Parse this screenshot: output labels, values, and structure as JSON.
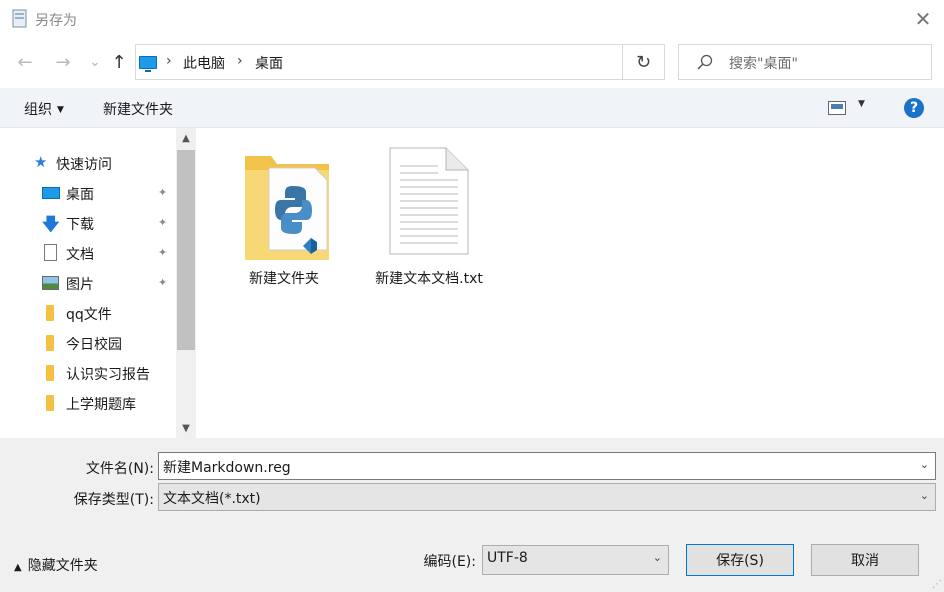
{
  "window": {
    "title": "另存为",
    "close_glyph": "✕"
  },
  "nav": {
    "back_glyph": "←",
    "forward_glyph": "→",
    "recent_glyph": "⌄",
    "up_glyph": "↑",
    "breadcrumb": [
      "此电脑",
      "桌面"
    ],
    "separator": "›",
    "refresh_glyph": "↻",
    "search_placeholder": "搜索\"桌面\""
  },
  "toolbar": {
    "organize_label": "组织",
    "new_folder_label": "新建文件夹",
    "help_glyph": "?"
  },
  "sidebar": {
    "items": [
      {
        "label": "快速访问",
        "icon": "star-icon",
        "pinned": false
      },
      {
        "label": "桌面",
        "icon": "desktop-icon",
        "pinned": true
      },
      {
        "label": "下载",
        "icon": "download-icon",
        "pinned": true
      },
      {
        "label": "文档",
        "icon": "document-icon",
        "pinned": true
      },
      {
        "label": "图片",
        "icon": "picture-icon",
        "pinned": true
      },
      {
        "label": "qq文件",
        "icon": "folder-icon",
        "pinned": false
      },
      {
        "label": "今日校园",
        "icon": "folder-icon",
        "pinned": false
      },
      {
        "label": "认识实习报告",
        "icon": "folder-icon",
        "pinned": false
      },
      {
        "label": "上学期题库",
        "icon": "folder-icon",
        "pinned": false
      }
    ],
    "pin_glyph": "📌",
    "scroll_up_glyph": "▲",
    "scroll_down_glyph": "▼"
  },
  "files": [
    {
      "name": "新建文件夹",
      "icon": "folder-python-vscode-icon"
    },
    {
      "name": "新建文本文档.txt",
      "icon": "text-file-icon"
    }
  ],
  "form": {
    "filename_label": "文件名(N):",
    "filename_value": "新建Markdown.reg",
    "filetype_label": "保存类型(T):",
    "filetype_value": "文本文档(*.txt)",
    "encoding_label": "编码(E):",
    "encoding_value": "UTF-8",
    "dropdown_glyph": "⌄"
  },
  "footer": {
    "hide_folders_label": "隐藏文件夹",
    "hide_glyph": "▲",
    "save_label": "保存(S)",
    "cancel_label": "取消"
  },
  "colors": {
    "accent": "#0078d7",
    "toolbar_bg": "#f0f3f8",
    "folder_yellow": "#f4c142",
    "help_blue": "#1a73c9"
  }
}
